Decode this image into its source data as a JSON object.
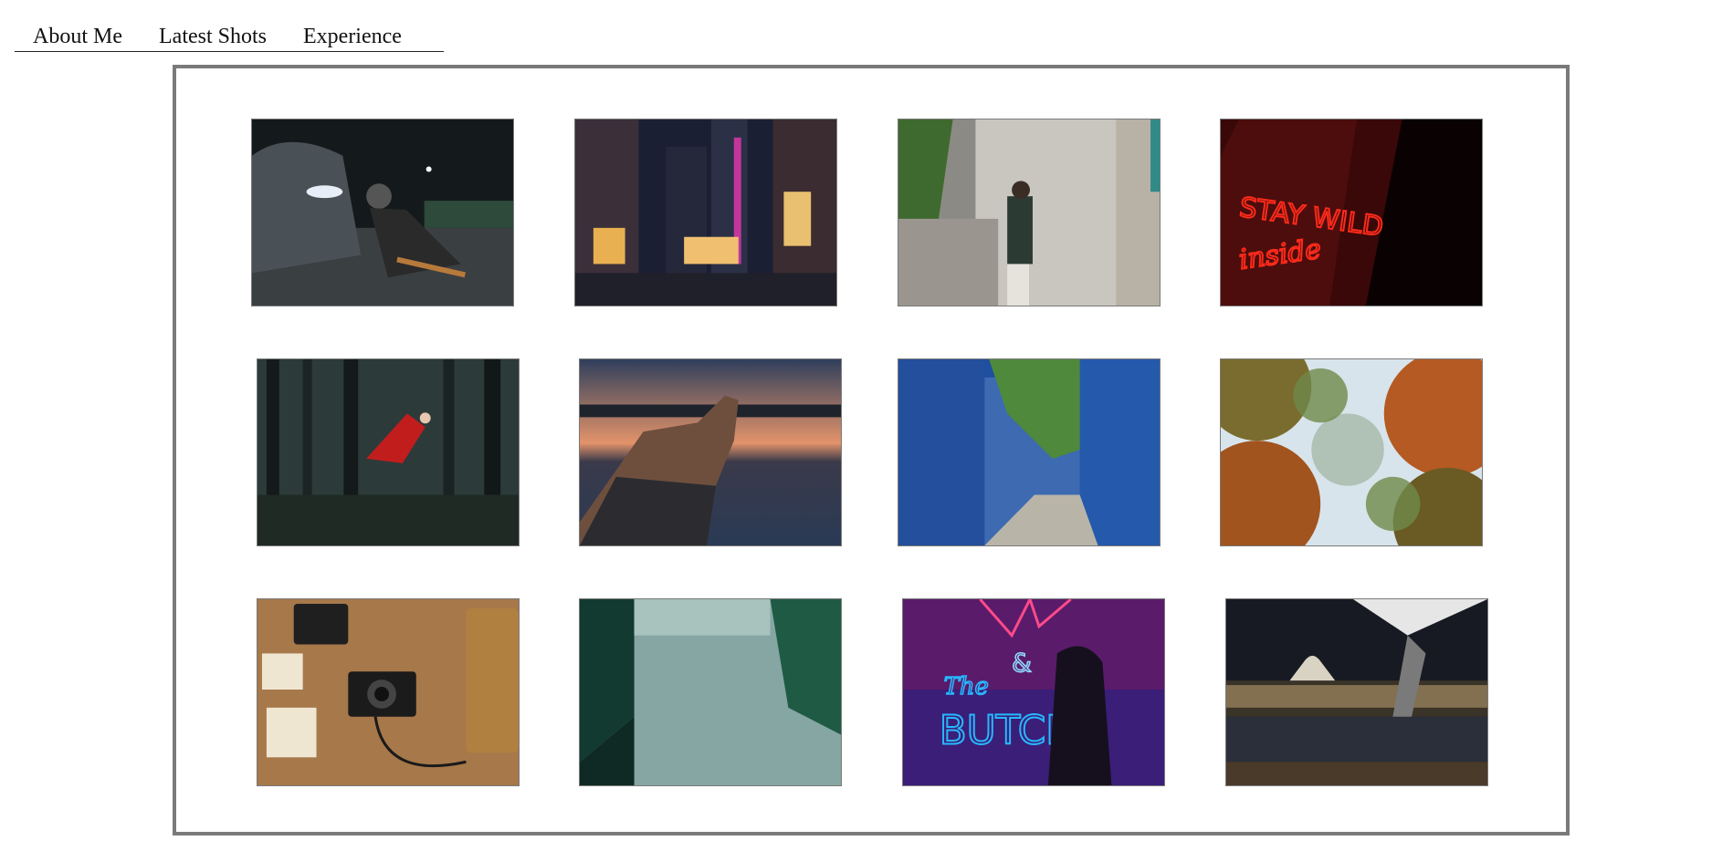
{
  "nav": {
    "items": [
      {
        "label": "About Me"
      },
      {
        "label": "Latest Shots"
      },
      {
        "label": "Experience"
      }
    ]
  },
  "gallery": {
    "photos": [
      {
        "icon": "photo-icon",
        "neon_text": ""
      },
      {
        "icon": "photo-icon",
        "neon_text": ""
      },
      {
        "icon": "photo-icon",
        "neon_text": ""
      },
      {
        "icon": "photo-icon",
        "neon_text": "STAY WILD inside"
      },
      {
        "icon": "photo-icon",
        "neon_text": ""
      },
      {
        "icon": "photo-icon",
        "neon_text": ""
      },
      {
        "icon": "photo-icon",
        "neon_text": ""
      },
      {
        "icon": "photo-icon",
        "neon_text": ""
      },
      {
        "icon": "photo-icon",
        "neon_text": ""
      },
      {
        "icon": "photo-icon",
        "neon_text": ""
      },
      {
        "icon": "photo-icon",
        "neon_text": "& The BUTCH"
      },
      {
        "icon": "photo-icon",
        "neon_text": ""
      }
    ]
  },
  "colors": {
    "frame_border": "#7a7a7a",
    "nav_text": "#111111",
    "neon_red": "#ff2a1a",
    "neon_blue": "#27b8ff"
  }
}
